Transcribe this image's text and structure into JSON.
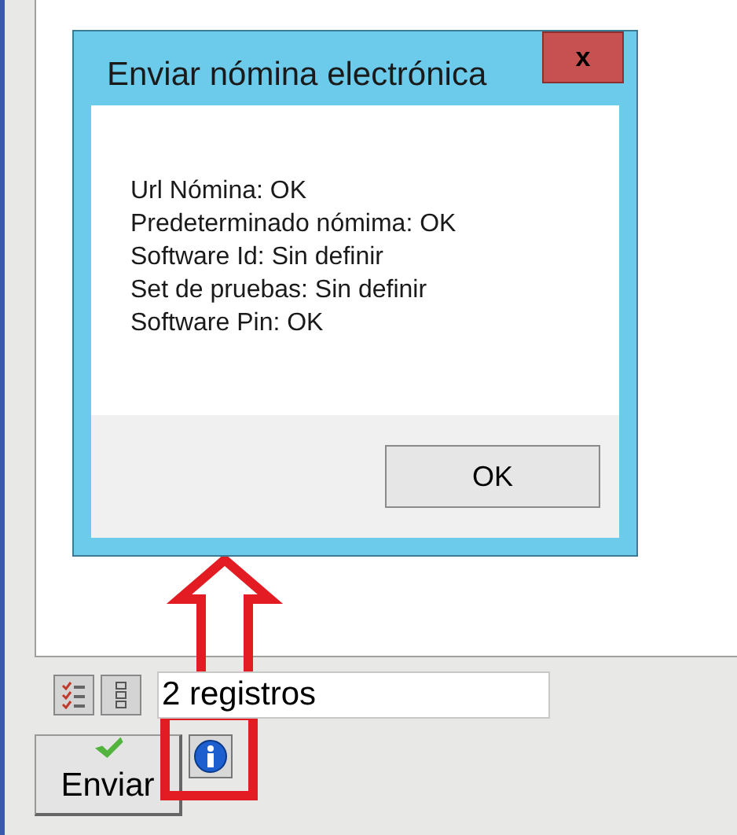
{
  "dialog": {
    "title": "Enviar nómina electrónica",
    "close": "x",
    "lines": [
      "Url Nómina: OK",
      "Predeterminado nómima: OK",
      "Software Id: Sin definir",
      "Set de pruebas: Sin definir",
      "Software Pin: OK"
    ],
    "button": "OK"
  },
  "footer": {
    "count_field": "2 registros",
    "send_button": "Enviar"
  }
}
